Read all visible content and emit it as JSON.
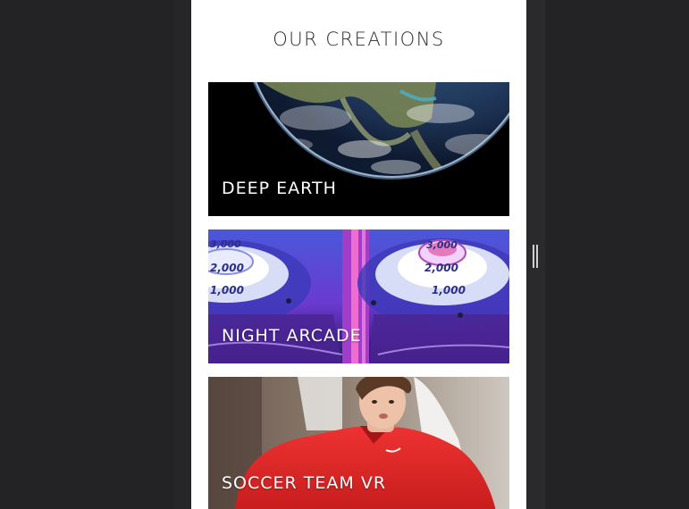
{
  "page": {
    "title": "OUR CREATIONS"
  },
  "creations": [
    {
      "label": "DEEP EARTH",
      "image": "earth-from-space-image"
    },
    {
      "label": "NIGHT ARCADE",
      "image": "skee-ball-arcade-image"
    },
    {
      "label": "SOCCER TEAM VR",
      "image": "soccer-player-image"
    }
  ],
  "colors": {
    "background": "#232325",
    "card_background": "#ffffff",
    "title": "#2c2c2c",
    "label": "#ffffff",
    "soccer_jersey": "#e32626",
    "arcade_purple": "#6b3ad1"
  }
}
